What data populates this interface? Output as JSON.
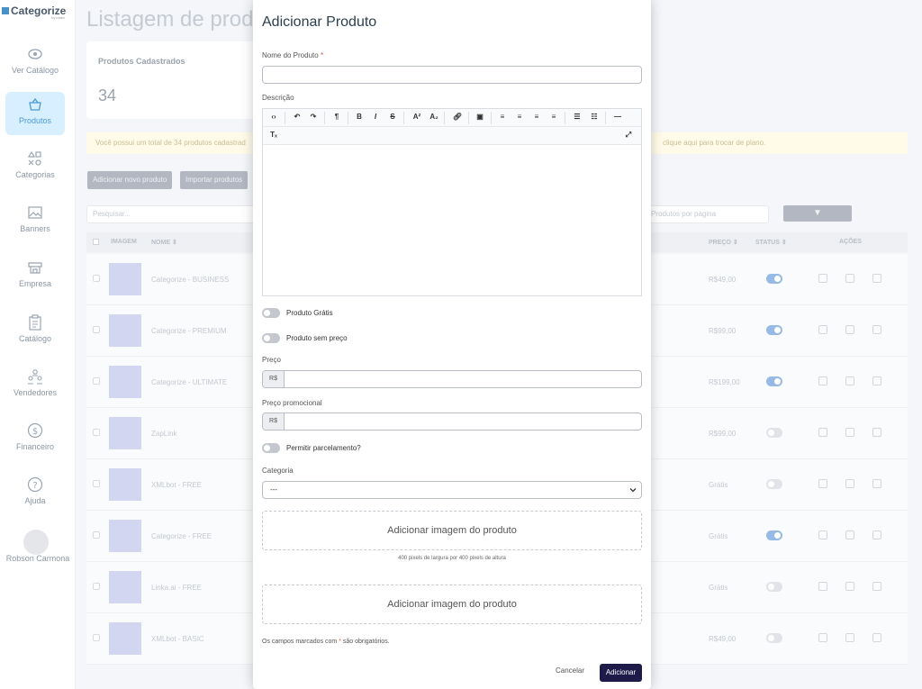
{
  "sidebar": {
    "logo": "Categorize",
    "logo_by": "by index",
    "items": [
      {
        "label": "Ver Catálogo",
        "icon": "eye-icon"
      },
      {
        "label": "Produtos",
        "icon": "basket-icon"
      },
      {
        "label": "Categorias",
        "icon": "shapes-icon"
      },
      {
        "label": "Banners",
        "icon": "image-icon"
      },
      {
        "label": "Empresa",
        "icon": "store-icon"
      },
      {
        "label": "Catálogo",
        "icon": "clipboard-icon"
      },
      {
        "label": "Vendedores",
        "icon": "team-icon"
      },
      {
        "label": "Financeiro",
        "icon": "dollar-icon"
      },
      {
        "label": "Ajuda",
        "icon": "help-icon"
      }
    ],
    "user": "Robson Carmona"
  },
  "page": {
    "title": "Listagem de produ",
    "stat_title": "Produtos Cadastrados",
    "stat_value": "34",
    "notice_left": "Você possui um total de 34 produtos cadastrad",
    "notice_right": "clique aqui para trocar de plano.",
    "btn_add": "Adicionar novo produto",
    "btn_import": "Importar produtos",
    "search_placeholder": "Pesquisar...",
    "per_page": "Produtos por página",
    "columns": {
      "image": "IMAGEM",
      "name": "NOME ⇕",
      "price": "PREÇO ⇕",
      "status": "STATUS ⇕",
      "actions": "AÇÕES"
    },
    "rows": [
      {
        "name": "Categorize - BUSINESS",
        "price": "R$49,00",
        "status": true
      },
      {
        "name": "Categorize - PREMIUM",
        "price": "R$99,00",
        "status": true
      },
      {
        "name": "Categorize - ULTIMATE",
        "price": "R$199,00",
        "status": true
      },
      {
        "name": "ZapLink",
        "price": "R$99,00",
        "status": false
      },
      {
        "name": "XMLbot - FREE",
        "price": "Grátis",
        "status": false
      },
      {
        "name": "Categorize - FREE",
        "price": "Grátis",
        "status": true
      },
      {
        "name": "Linka.ai - FREE",
        "price": "Grátis",
        "status": false
      },
      {
        "name": "XMLbot - BASIC",
        "price": "R$49,00",
        "status": false
      }
    ]
  },
  "modal": {
    "title": "Adicionar Produto",
    "name_label": "Nome do Produto",
    "required_mark": "*",
    "description_label": "Descrição",
    "toggle_free": "Produto Grátis",
    "toggle_no_price": "Produto sem preço",
    "price_label": "Preço",
    "promo_label": "Preço promocional",
    "currency": "R$",
    "toggle_installments": "Permitir parcelamento?",
    "category_label": "Categoria",
    "category_value": "---",
    "image_drop_1": "Adicionar imagem do produto",
    "image_hint": "400 pixels de largura por 400 pixels de altura",
    "image_drop_2": "Adicionar imagem do produto",
    "footnote_pre": "Os campos marcados com",
    "footnote_post": "são obrigatórios.",
    "cancel": "Cancelar",
    "submit": "Adicionar"
  }
}
